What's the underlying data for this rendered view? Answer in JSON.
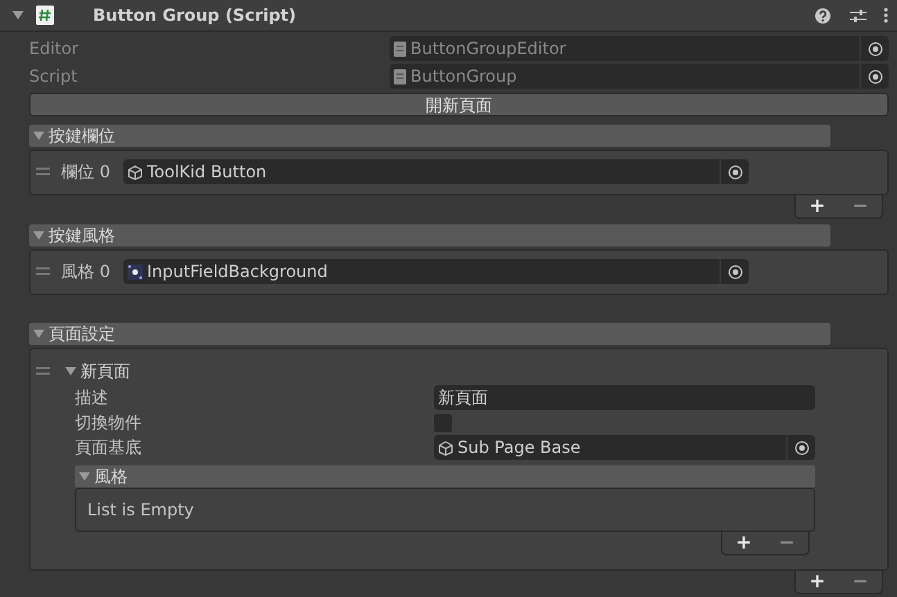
{
  "component": {
    "title": "Button Group (Script)",
    "expanded": true
  },
  "script_fields": [
    {
      "label": "Editor",
      "value": "ButtonGroupEditor",
      "kind": "script",
      "disabled": true
    },
    {
      "label": "Script",
      "value": "ButtonGroup",
      "kind": "script",
      "disabled": true
    }
  ],
  "open_button": {
    "label": "開新頁面"
  },
  "sections": [
    {
      "kind": "object_list",
      "title": "按鍵欄位",
      "expanded": true,
      "items": [
        {
          "label": "欄位 0",
          "value": "ToolKid Button",
          "kind": "prefab"
        }
      ],
      "footer": {
        "add": "+",
        "remove": "−"
      }
    },
    {
      "kind": "object_list",
      "title": "按鍵風格",
      "expanded": true,
      "items": [
        {
          "label": "風格 0",
          "value": "InputFieldBackground",
          "kind": "sprite"
        }
      ]
    },
    {
      "kind": "page_list",
      "title": "頁面設定",
      "expanded": true,
      "items": [
        {
          "title": "新頁面",
          "expanded": true,
          "fields": [
            {
              "kind": "text",
              "label": "描述",
              "value": "新頁面"
            },
            {
              "kind": "toggle",
              "label": "切換物件",
              "checked": false
            },
            {
              "kind": "object",
              "label": "頁面基底",
              "value": "Sub Page Base"
            }
          ],
          "nested": {
            "title": "風格",
            "expanded": true,
            "empty_text": "List is Empty",
            "footer": {
              "add": "+",
              "remove": "−"
            }
          }
        }
      ],
      "footer": {
        "add": "+",
        "remove": "−"
      }
    }
  ]
}
